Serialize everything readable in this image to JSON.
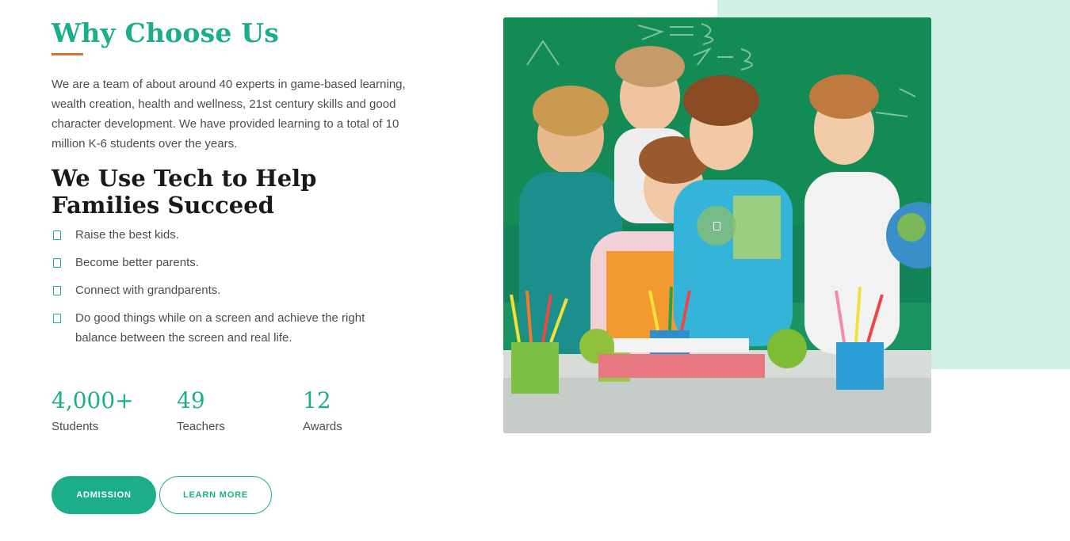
{
  "section": {
    "title": "Why Choose Us",
    "description": "We are a team of about around 40 experts in game-based learning, wealth creation, health and wellness, 21st century skills and good character development. We have provided learning to a total of 10 million K-6 students over the years.",
    "subtitle": "We Use Tech to Help Families Succeed",
    "features": [
      "Raise the best kids.",
      "Become better parents.",
      "Connect with grandparents.",
      "Do good things while on a screen and achieve the right balance between the screen and real life."
    ],
    "stats": [
      {
        "value": "4,000+",
        "label": "Students"
      },
      {
        "value": "49",
        "label": "Teachers"
      },
      {
        "value": "12",
        "label": "Awards"
      }
    ],
    "buttons": {
      "admission": "ADMISSION",
      "learn_more": "LEARN MORE"
    }
  },
  "colors": {
    "accent": "#1cae8b",
    "underline": "#e16f2e",
    "mint_background": "#d1f0e6"
  },
  "icons": {
    "feature_bullet": "checkbox-icon",
    "video": "play-icon"
  }
}
